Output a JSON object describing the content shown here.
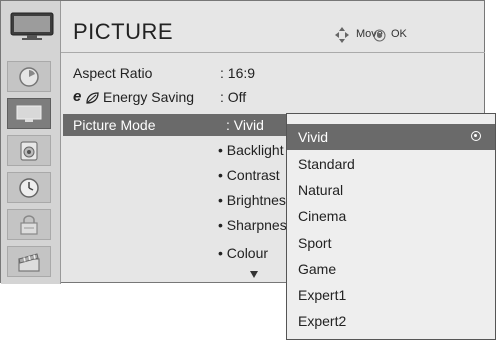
{
  "header": {
    "title": "PICTURE",
    "move_hint": "Move",
    "ok_hint": "OK"
  },
  "sidebar": {
    "items": [
      {
        "icon": "clock-dial-icon"
      },
      {
        "icon": "tv-screen-icon",
        "active": true
      },
      {
        "icon": "speaker-icon"
      },
      {
        "icon": "clock-icon"
      },
      {
        "icon": "lock-icon"
      },
      {
        "icon": "clapperboard-icon"
      }
    ]
  },
  "settings": [
    {
      "label": "Aspect Ratio",
      "value": ": 16:9"
    },
    {
      "label": "Energy Saving",
      "value": ": Off"
    },
    {
      "label": "Picture Mode",
      "value": ": Vivid"
    }
  ],
  "energy_saving_logo": "e",
  "sub_items": [
    "• Backlight",
    "• Contrast",
    "• Brightness",
    "• Sharpness",
    "• Colour"
  ],
  "dropdown": {
    "options": [
      "Vivid",
      "Standard",
      "Natural",
      "Cinema",
      "Sport",
      "Game",
      "Expert1",
      "Expert2"
    ],
    "selected": "Vivid"
  },
  "colors": {
    "panel_bg": "#e6e6e6",
    "highlight": "#6a6a6a",
    "dropdown_bg": "#eeeeee"
  }
}
